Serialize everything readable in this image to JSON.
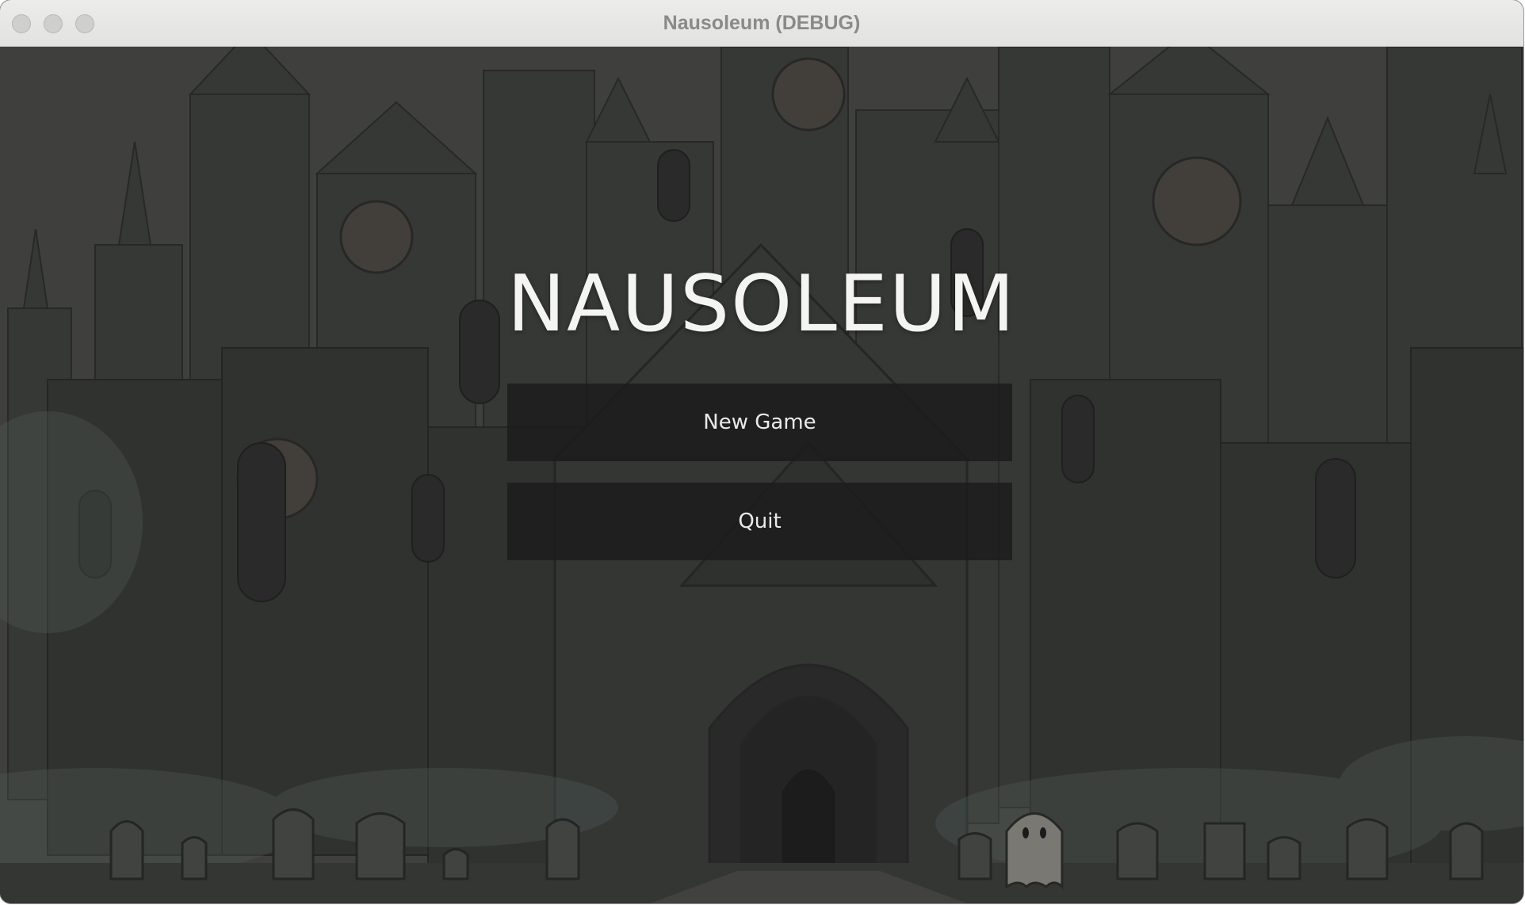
{
  "window": {
    "title": "Nausoleum (DEBUG)"
  },
  "menu": {
    "title": "NAUSOLEUM",
    "buttons": [
      {
        "label": "New Game"
      },
      {
        "label": "Quit"
      }
    ]
  },
  "colors": {
    "button_bg": "#1c1c1c",
    "title_text": "#f4f4f2",
    "scene_dark": "#333633",
    "scene_mid": "#3e423f"
  }
}
